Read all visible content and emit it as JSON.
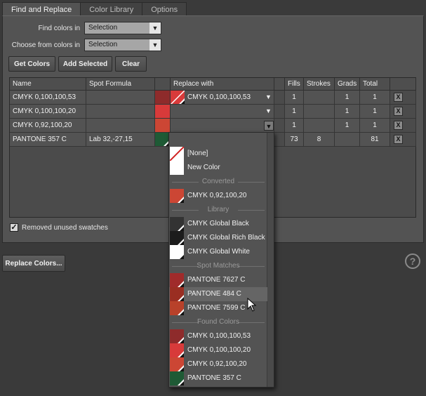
{
  "tabs": [
    "Find and Replace",
    "Color Library",
    "Options"
  ],
  "find_colors_in": {
    "label": "Find colors in",
    "value": "Selection"
  },
  "choose_from_colors_in": {
    "label": "Choose from colors in",
    "value": "Selection"
  },
  "buttons": {
    "get_colors": "Get Colors",
    "add_selected": "Add Selected",
    "clear": "Clear",
    "replace_colors": "Replace Colors..."
  },
  "table": {
    "headers": [
      "Name",
      "Spot Formula",
      "",
      "Replace with",
      "",
      "Fills",
      "Strokes",
      "Grads",
      "Total",
      ""
    ],
    "rows": [
      {
        "name": "CMYK 0,100,100,53",
        "spot": "",
        "color": "#8e2b2b",
        "replace": "CMYK 0,100,100,53",
        "replace_color": "#d83a3a",
        "fills": "1",
        "strokes": "",
        "grads": "1",
        "total": "1"
      },
      {
        "name": "CMYK 0,100,100,20",
        "spot": "",
        "color": "#d83a3a",
        "replace": "",
        "replace_color": "",
        "fills": "1",
        "strokes": "",
        "grads": "1",
        "total": "1"
      },
      {
        "name": "CMYK 0,92,100,20",
        "spot": "",
        "color": "#cc4634",
        "replace": "",
        "replace_color": "",
        "fills": "1",
        "strokes": "",
        "grads": "1",
        "total": "1"
      },
      {
        "name": "PANTONE 357 C",
        "spot": "Lab 32,-27,15",
        "color": "#1e5a35",
        "replace": "",
        "replace_color": "",
        "fills": "73",
        "strokes": "8",
        "grads": "",
        "total": "81"
      }
    ],
    "remove_label": "X"
  },
  "removed_unused": {
    "label": "Removed unused swatches",
    "checked": true
  },
  "help": "?",
  "dropdown": {
    "items": [
      {
        "type": "item",
        "label": "[None]",
        "swatch": "none"
      },
      {
        "type": "item",
        "label": "New Color",
        "swatch": "#ffffff"
      },
      {
        "type": "sep",
        "label": "Converted"
      },
      {
        "type": "item",
        "label": "CMYK 0,92,100,20",
        "swatch": "#cc4634"
      },
      {
        "type": "sep",
        "label": "Library"
      },
      {
        "type": "item",
        "label": "CMYK Global Black",
        "swatch": "#333333"
      },
      {
        "type": "item",
        "label": "CMYK Global Rich Black",
        "swatch": "#1c1c1c"
      },
      {
        "type": "item",
        "label": "CMYK Global White",
        "swatch": "#ffffff"
      },
      {
        "type": "sep",
        "label": "Spot Matches"
      },
      {
        "type": "item",
        "label": "PANTONE 7627 C",
        "swatch": "#a02b2b"
      },
      {
        "type": "item",
        "label": "PANTONE 484 C",
        "swatch": "#9a2e22",
        "highlight": true
      },
      {
        "type": "item",
        "label": "PANTONE 7599 C",
        "swatch": "#b8412a"
      },
      {
        "type": "sep",
        "label": "Found Colors"
      },
      {
        "type": "item",
        "label": "CMYK 0,100,100,53",
        "swatch": "#8e2b2b"
      },
      {
        "type": "item",
        "label": "CMYK 0,100,100,20",
        "swatch": "#d83a3a"
      },
      {
        "type": "item",
        "label": "CMYK 0,92,100,20",
        "swatch": "#cc4634"
      },
      {
        "type": "item",
        "label": "PANTONE 357 C",
        "swatch": "#1e5a35"
      }
    ]
  }
}
